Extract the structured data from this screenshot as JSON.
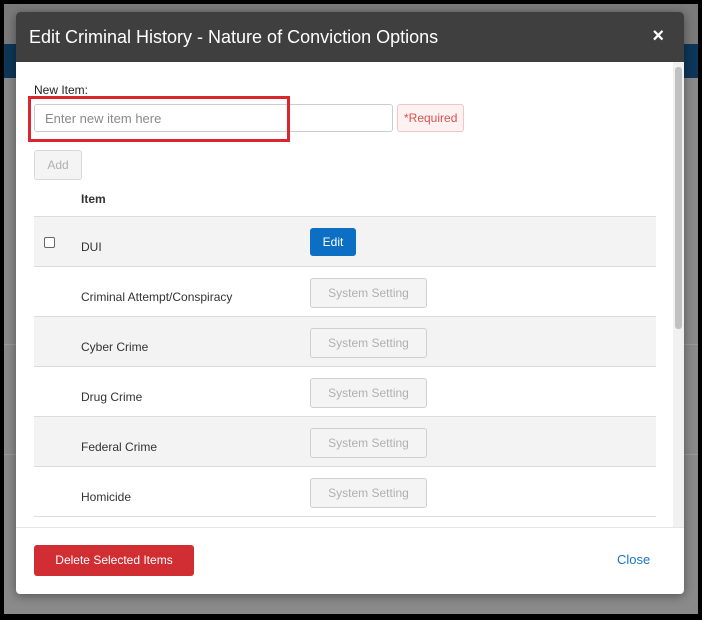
{
  "modal": {
    "title": "Edit Criminal History - Nature of Conviction Options",
    "close_icon": "×"
  },
  "form": {
    "new_item_label": "New Item:",
    "input_placeholder": "Enter new item here",
    "input_value": "",
    "required_text": "*Required",
    "add_label": "Add"
  },
  "table": {
    "column_header": "Item",
    "rows": [
      {
        "item": "DUI",
        "action": "Edit"
      },
      {
        "item": "Criminal Attempt/Conspiracy",
        "action": "System Setting"
      },
      {
        "item": "Cyber Crime",
        "action": "System Setting"
      },
      {
        "item": "Drug Crime",
        "action": "System Setting"
      },
      {
        "item": "Federal Crime",
        "action": "System Setting"
      },
      {
        "item": "Homicide",
        "action": "System Setting"
      }
    ]
  },
  "footer": {
    "delete_label": "Delete Selected Items",
    "close_label": "Close"
  },
  "colors": {
    "header_bg": "#3f3f3f",
    "primary_blue": "#0c6fc4",
    "danger_red": "#d12e34",
    "highlight_red": "#d9262f",
    "required_text": "#d9534f"
  }
}
